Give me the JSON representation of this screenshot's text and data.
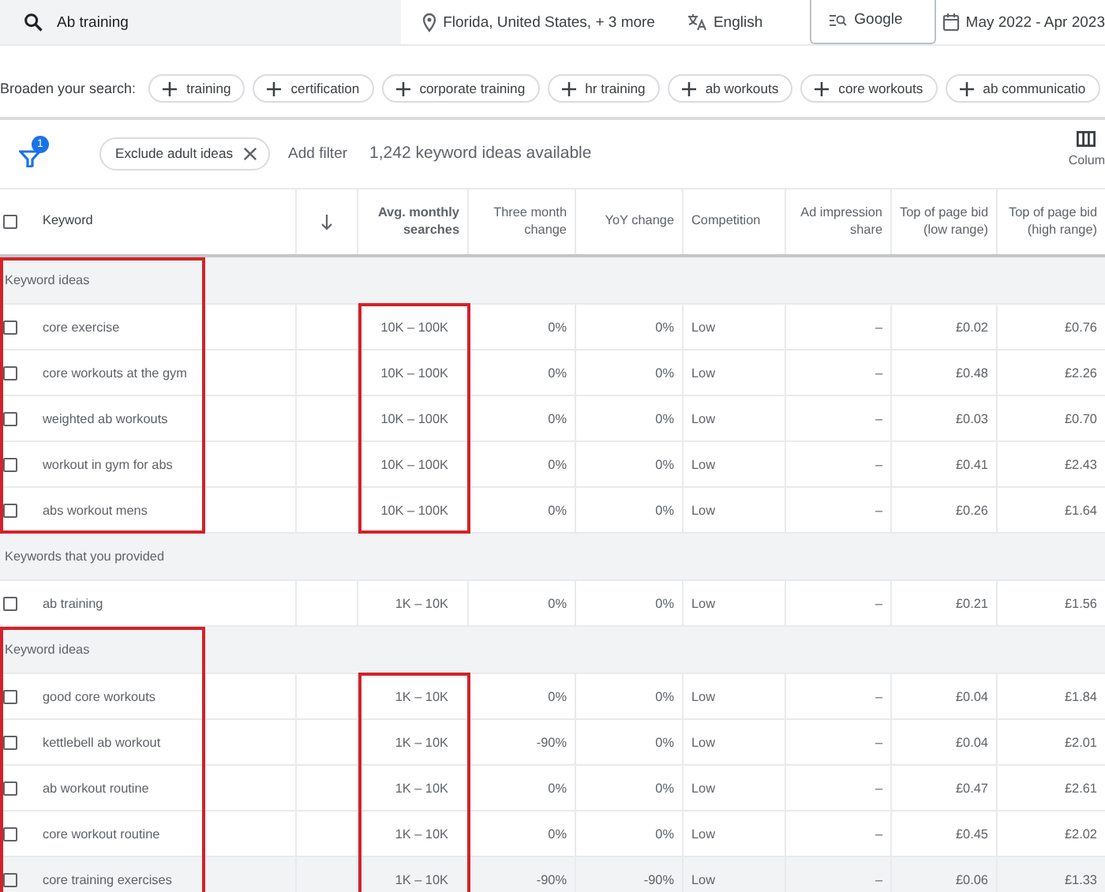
{
  "top_bar": {
    "search": {
      "value": "Ab training"
    },
    "location": "Florida, United States, + 3 more",
    "language": "English",
    "network": "Google",
    "date_range": "May 2022 - Apr 2023"
  },
  "broaden": {
    "label": "Broaden your search:",
    "chips": [
      "training",
      "certification",
      "corporate training",
      "hr training",
      "ab workouts",
      "core workouts",
      "ab communicatio"
    ]
  },
  "filter_bar": {
    "filter_count": "1",
    "chips": [
      "Exclude adult ideas"
    ],
    "add_filter": "Add filter",
    "summary": "1,242 keyword ideas available",
    "columns_button": "Colum"
  },
  "table": {
    "select_all": {
      "checked": false
    },
    "columns": [
      "Keyword",
      "Avg. monthly searches",
      "Three month change",
      "YoY change",
      "Competition",
      "Ad impression share",
      "Top of page bid (low range)",
      "Top of page bid (high range)"
    ],
    "groups": [
      {
        "label": "Keyword ideas",
        "highlighted": true,
        "rows": [
          {
            "keyword": "core exercise",
            "searches": "10K – 100K",
            "three_month": "0%",
            "yoy": "0%",
            "competition": "Low",
            "impression": "–",
            "bid_low": "£0.02",
            "bid_high": "£0.76",
            "checked": false,
            "hovered": false
          },
          {
            "keyword": "core workouts at the gym",
            "searches": "10K – 100K",
            "three_month": "0%",
            "yoy": "0%",
            "competition": "Low",
            "impression": "–",
            "bid_low": "£0.48",
            "bid_high": "£2.26",
            "checked": false,
            "hovered": false
          },
          {
            "keyword": "weighted ab workouts",
            "searches": "10K – 100K",
            "three_month": "0%",
            "yoy": "0%",
            "competition": "Low",
            "impression": "–",
            "bid_low": "£0.03",
            "bid_high": "£0.70",
            "checked": false,
            "hovered": false
          },
          {
            "keyword": "workout in gym for abs",
            "searches": "10K – 100K",
            "three_month": "0%",
            "yoy": "0%",
            "competition": "Low",
            "impression": "–",
            "bid_low": "£0.41",
            "bid_high": "£2.43",
            "checked": false,
            "hovered": false
          },
          {
            "keyword": "abs workout mens",
            "searches": "10K – 100K",
            "three_month": "0%",
            "yoy": "0%",
            "competition": "Low",
            "impression": "–",
            "bid_low": "£0.26",
            "bid_high": "£1.64",
            "checked": false,
            "hovered": false
          }
        ]
      },
      {
        "label": "Keywords that you provided",
        "highlighted": false,
        "rows": [
          {
            "keyword": "ab training",
            "searches": "1K – 10K",
            "three_month": "0%",
            "yoy": "0%",
            "competition": "Low",
            "impression": "–",
            "bid_low": "£0.21",
            "bid_high": "£1.56",
            "checked": false,
            "hovered": false
          }
        ]
      },
      {
        "label": "Keyword ideas",
        "highlighted": true,
        "rows": [
          {
            "keyword": "good core workouts",
            "searches": "1K – 10K",
            "three_month": "0%",
            "yoy": "0%",
            "competition": "Low",
            "impression": "–",
            "bid_low": "£0.04",
            "bid_high": "£1.84",
            "checked": false,
            "hovered": false
          },
          {
            "keyword": "kettlebell ab workout",
            "searches": "1K – 10K",
            "three_month": "-90%",
            "yoy": "0%",
            "competition": "Low",
            "impression": "–",
            "bid_low": "£0.04",
            "bid_high": "£2.01",
            "checked": false,
            "hovered": false
          },
          {
            "keyword": "ab workout routine",
            "searches": "1K – 10K",
            "three_month": "0%",
            "yoy": "0%",
            "competition": "Low",
            "impression": "–",
            "bid_low": "£0.47",
            "bid_high": "£2.61",
            "checked": false,
            "hovered": false
          },
          {
            "keyword": "core workout routine",
            "searches": "1K – 10K",
            "three_month": "0%",
            "yoy": "0%",
            "competition": "Low",
            "impression": "–",
            "bid_low": "£0.45",
            "bid_high": "£2.02",
            "checked": false,
            "hovered": false
          },
          {
            "keyword": "core training exercises",
            "searches": "1K – 10K",
            "three_month": "-90%",
            "yoy": "-90%",
            "competition": "Low",
            "impression": "–",
            "bid_low": "£0.06",
            "bid_high": "£1.33",
            "checked": false,
            "hovered": true
          }
        ]
      }
    ]
  }
}
